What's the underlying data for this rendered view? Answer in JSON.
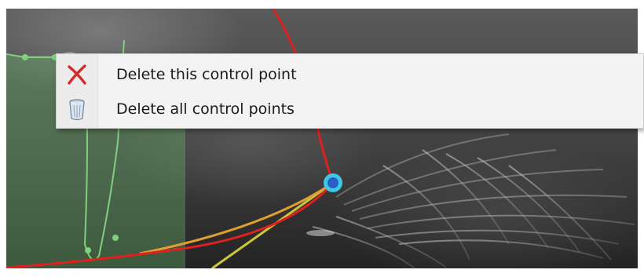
{
  "context_menu": {
    "items": [
      {
        "label": "Delete this control point",
        "icon": "red-x-delete-icon"
      },
      {
        "label": "Delete all control points",
        "icon": "trash-bin-icon"
      }
    ]
  },
  "colors": {
    "contour_red": "#e02020",
    "contour_green": "#7fd07f",
    "green_fill": "#6fbf6f",
    "control_point_fill": "#2a5fc8",
    "control_point_ring": "#3ec8e6",
    "guide_yellow": "#c8c83a",
    "guide_orange": "#e0a030"
  }
}
